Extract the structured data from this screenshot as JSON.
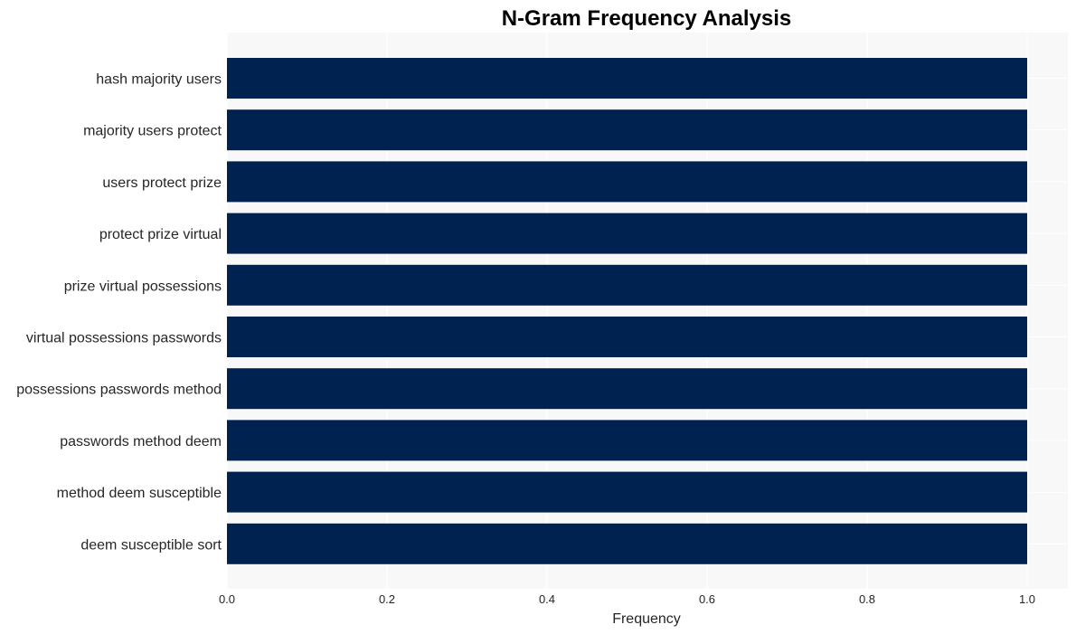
{
  "chart_data": {
    "type": "bar",
    "orientation": "horizontal",
    "title": "N-Gram Frequency Analysis",
    "xlabel": "Frequency",
    "ylabel": "",
    "categories": [
      "hash majority users",
      "majority users protect",
      "users protect prize",
      "protect prize virtual",
      "prize virtual possessions",
      "virtual possessions passwords",
      "possessions passwords method",
      "passwords method deem",
      "method deem susceptible",
      "deem susceptible sort"
    ],
    "values": [
      1,
      1,
      1,
      1,
      1,
      1,
      1,
      1,
      1,
      1
    ],
    "xlim": [
      0,
      1.05
    ],
    "xticks": [
      0.0,
      0.2,
      0.4,
      0.6,
      0.8,
      1.0
    ],
    "xtick_labels": [
      "0.0",
      "0.2",
      "0.4",
      "0.6",
      "0.8",
      "1.0"
    ],
    "grid": true,
    "legend": "none",
    "colors": {
      "bar": "#002251",
      "plot_background": "#f8f8f8",
      "grid": "#ffffff"
    }
  }
}
